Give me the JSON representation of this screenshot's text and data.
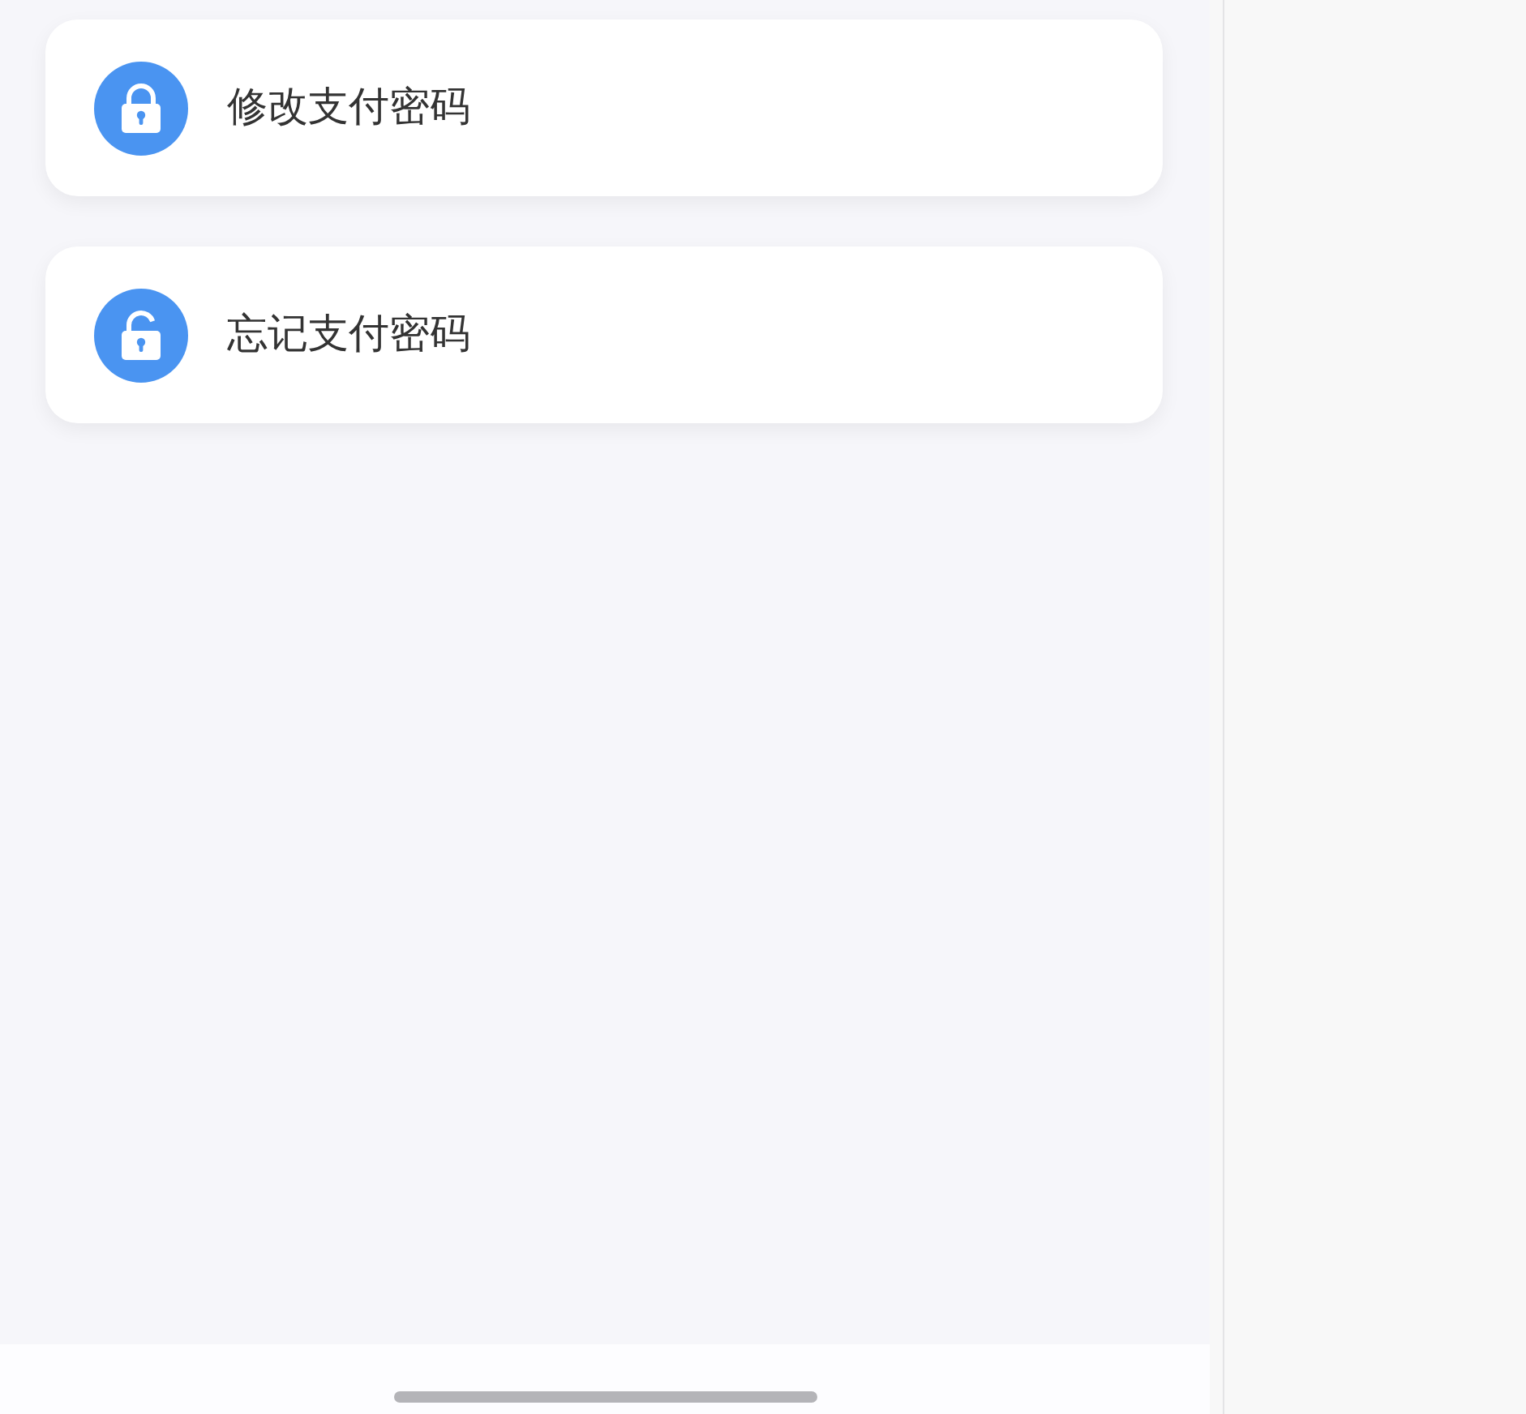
{
  "menu_items": [
    {
      "kind": "locked",
      "label": "修改支付密码"
    },
    {
      "kind": "unlocked",
      "label": "忘记支付密码"
    }
  ]
}
